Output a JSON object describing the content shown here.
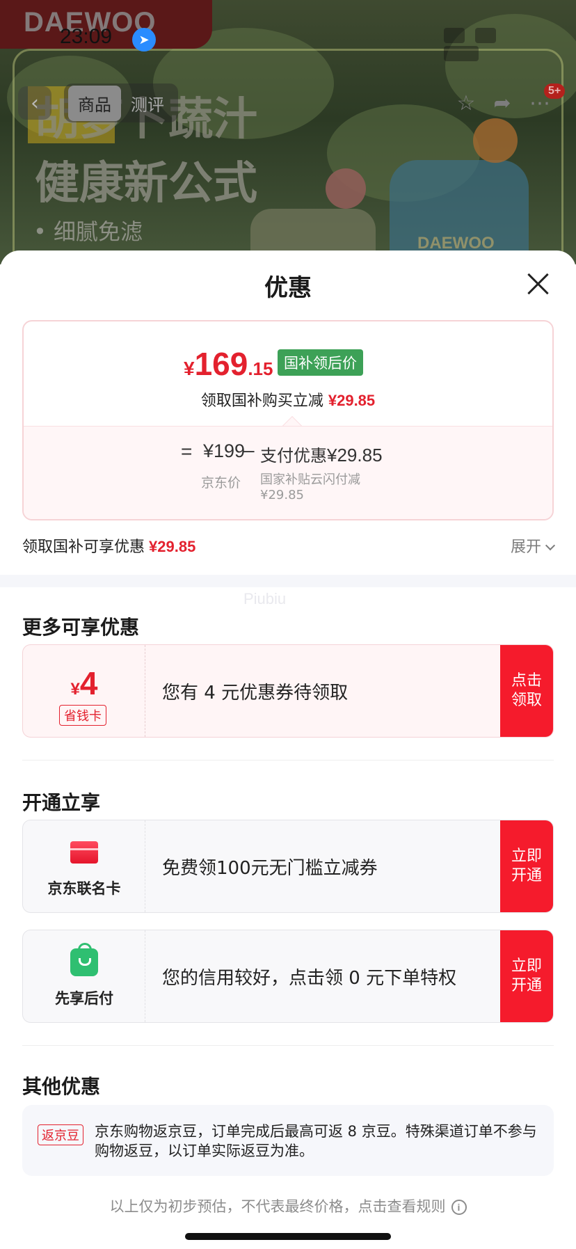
{
  "status_bar": {
    "time": "23:09"
  },
  "background": {
    "brand": "DAEWOO",
    "hero_line1": "胡萝卜蔬汁",
    "hero_line2": "健康新公式",
    "hero_line3": "• 细腻免滤",
    "brand_mark": "DAEWOO",
    "nav_tabs": [
      "商品",
      "测评"
    ],
    "cart_badge": "5+"
  },
  "sheet": {
    "title": "优惠",
    "price_card": {
      "currency": "¥",
      "price_int": "169",
      "price_dec": ".15",
      "tag": "国补领后价",
      "sub_text": "领取国补购买立减",
      "sub_amount": "¥29.85",
      "eq": "=",
      "jd_price": "¥199",
      "jd_label": "京东价",
      "minus": "–",
      "pay_label": "支付优惠",
      "pay_amount": "¥29.85",
      "pay_desc_line1": "国家补贴云闪付减",
      "pay_desc_line2": "¥29.85"
    },
    "gov_row": {
      "text": "领取国补可享优惠",
      "amount": "¥29.85",
      "expand": "展开"
    },
    "watermark": "Piubiu",
    "more_section": {
      "title": "更多可享优惠",
      "coupon": {
        "currency": "¥",
        "amount": "4",
        "tag": "省钱卡",
        "desc": "您有 4 元优惠券待领取",
        "cta": "点击领取"
      }
    },
    "open_section": {
      "title": "开通立享",
      "items": [
        {
          "label": "京东联名卡",
          "desc": "免费领100元无门槛立减券",
          "cta": "立即开通"
        },
        {
          "label": "先享后付",
          "desc": "您的信用较好，点击领 0 元下单特权",
          "cta": "立即开通"
        }
      ]
    },
    "other_section": {
      "title": "其他优惠",
      "tag": "返京豆",
      "text": "京东购物返京豆，订单完成后最高可返 8 京豆。特殊渠道订单不参与购物返豆，以订单实际返豆为准。"
    },
    "footnote": "以上仅为初步预估，不代表最终价格，点击查看规则"
  }
}
